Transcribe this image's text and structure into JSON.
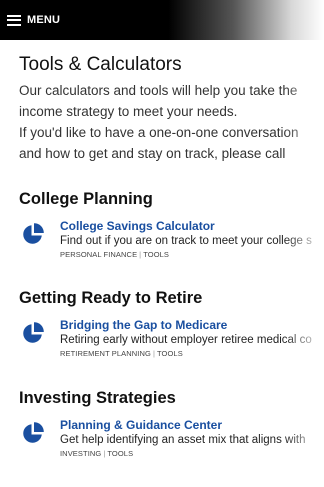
{
  "header": {
    "menu_label": "MENU"
  },
  "page": {
    "title": "Tools & Calculators",
    "intro_lines": [
      "Our calculators and tools will help you take the",
      "income strategy to meet your needs.",
      "If you'd like to have a one-on-one conversation",
      "and how to get and stay on track, please call"
    ]
  },
  "sections": [
    {
      "heading": "College Planning",
      "item": {
        "icon": "pie-chart-icon",
        "title": "College Savings Calculator",
        "description": "Find out if you are on track to meet your college s",
        "tag1": "PERSONAL FINANCE",
        "tag2": "TOOLS"
      }
    },
    {
      "heading": "Getting Ready to Retire",
      "item": {
        "icon": "pie-chart-icon",
        "title": "Bridging the Gap to Medicare",
        "description": "Retiring early without employer retiree medical co",
        "tag1": "RETIREMENT PLANNING",
        "tag2": "TOOLS"
      }
    },
    {
      "heading": "Investing Strategies",
      "item": {
        "icon": "pie-chart-icon",
        "title": "Planning & Guidance Center",
        "description": "Get help identifying an asset mix that aligns with",
        "tag1": "INVESTING",
        "tag2": "TOOLS"
      }
    }
  ],
  "colors": {
    "link": "#1a4fa0",
    "icon": "#1a4fa0"
  }
}
